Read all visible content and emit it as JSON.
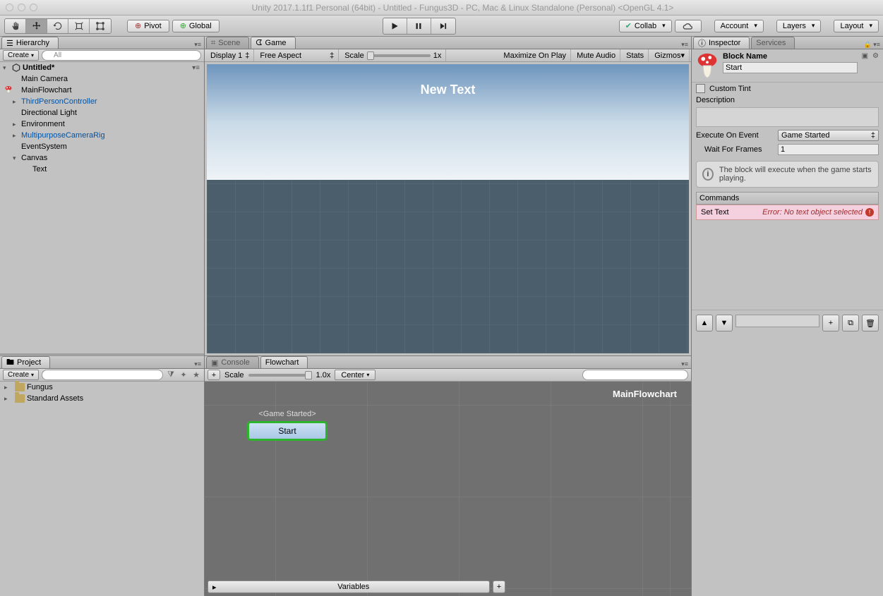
{
  "title": "Unity 2017.1.1f1 Personal (64bit) - Untitled - Fungus3D - PC, Mac & Linux Standalone (Personal) <OpenGL 4.1>",
  "toolbar": {
    "pivot": "Pivot",
    "global": "Global",
    "collab": "Collab",
    "account": "Account",
    "layers": "Layers",
    "layout": "Layout"
  },
  "hierarchy": {
    "tab": "Hierarchy",
    "create": "Create",
    "scene": "Untitled*",
    "items": [
      {
        "label": "Main Camera",
        "prefab": false
      },
      {
        "label": "MainFlowchart",
        "prefab": false,
        "badge": true
      },
      {
        "label": "ThirdPersonController",
        "prefab": true,
        "arrow": true
      },
      {
        "label": "Directional Light",
        "prefab": false
      },
      {
        "label": "Environment",
        "prefab": false,
        "arrow": true
      },
      {
        "label": "MultipurposeCameraRig",
        "prefab": true,
        "arrow": true
      },
      {
        "label": "EventSystem",
        "prefab": false
      },
      {
        "label": "Canvas",
        "prefab": false,
        "arrow": true,
        "children": [
          {
            "label": "Text"
          }
        ]
      }
    ]
  },
  "project": {
    "tab": "Project",
    "create": "Create",
    "items": [
      "Fungus",
      "Standard Assets"
    ]
  },
  "game": {
    "scene_tab": "Scene",
    "game_tab": "Game",
    "display": "Display 1",
    "aspect": "Free Aspect",
    "scale_label": "Scale",
    "scale_value": "1x",
    "maximize": "Maximize On Play",
    "mute": "Mute Audio",
    "stats": "Stats",
    "gizmos": "Gizmos",
    "canvas_text": "New Text"
  },
  "console": {
    "tab": "Console",
    "flow_tab": "Flowchart",
    "scale_label": "Scale",
    "scale_value": "1.0x",
    "center": "Center",
    "chart_name": "MainFlowchart",
    "event": "<Game Started>",
    "block": "Start",
    "variables": "Variables"
  },
  "inspector": {
    "tab": "Inspector",
    "services_tab": "Services",
    "block_name_label": "Block Name",
    "block_name": "Start",
    "custom_tint": "Custom Tint",
    "description": "Description",
    "execute_label": "Execute On Event",
    "execute_value": "Game Started",
    "wait_label": "Wait For Frames",
    "wait_value": "1",
    "help": "The block will execute when the game starts playing.",
    "commands_label": "Commands",
    "command_name": "Set Text",
    "command_error": "Error: No text object selected"
  }
}
